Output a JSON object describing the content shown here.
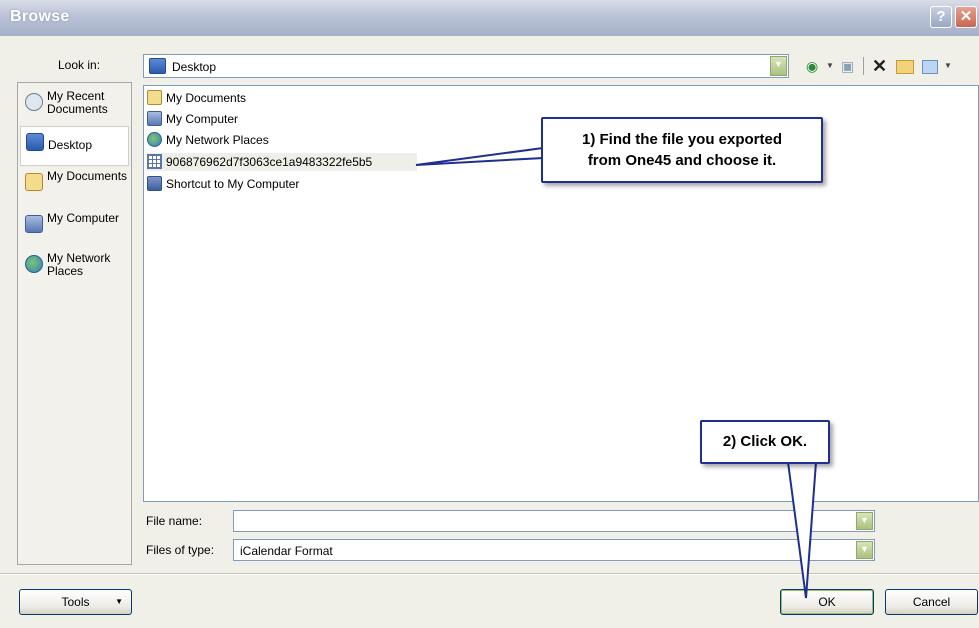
{
  "window": {
    "title": "Browse",
    "help_glyph": "?",
    "close_glyph": "✕"
  },
  "lookin": {
    "label": "Look in:",
    "value": "Desktop"
  },
  "toolbar": {
    "icons": [
      "back-icon",
      "up-folder-icon",
      "delete-icon",
      "new-folder-icon",
      "views-icon"
    ]
  },
  "places": [
    {
      "label": "My Recent Documents",
      "icon": "recent-documents-icon",
      "selected": false
    },
    {
      "label": "Desktop",
      "icon": "desktop-icon",
      "selected": true
    },
    {
      "label": "My Documents",
      "icon": "my-documents-icon",
      "selected": false
    },
    {
      "label": "My Computer",
      "icon": "my-computer-icon",
      "selected": false
    },
    {
      "label": "My Network Places",
      "icon": "network-places-icon",
      "selected": false
    }
  ],
  "files": [
    {
      "name": "My Documents",
      "icon": "my-documents-icon",
      "selected": false
    },
    {
      "name": "My Computer",
      "icon": "my-computer-icon",
      "selected": false
    },
    {
      "name": "My Network Places",
      "icon": "network-places-icon",
      "selected": false
    },
    {
      "name": "906876962d7f3063ce1a9483322fe5b5",
      "icon": "icalendar-file-icon",
      "selected": true
    },
    {
      "name": "Shortcut to My Computer",
      "icon": "shortcut-icon",
      "selected": false
    }
  ],
  "filename": {
    "label": "File name:",
    "value": ""
  },
  "filetype": {
    "label": "Files of type:",
    "value": "iCalendar Format"
  },
  "buttons": {
    "tools": "Tools",
    "ok": "OK",
    "cancel": "Cancel"
  },
  "callouts": {
    "step1_line1": "1)  Find the file you exported",
    "step1_line2": "from One45 and choose it.",
    "step2": "2)  Click OK."
  },
  "colors": {
    "callout_border": "#1f2f8f",
    "titlebar": "#b9c2d6",
    "dialog_bg": "#f0efe8"
  }
}
